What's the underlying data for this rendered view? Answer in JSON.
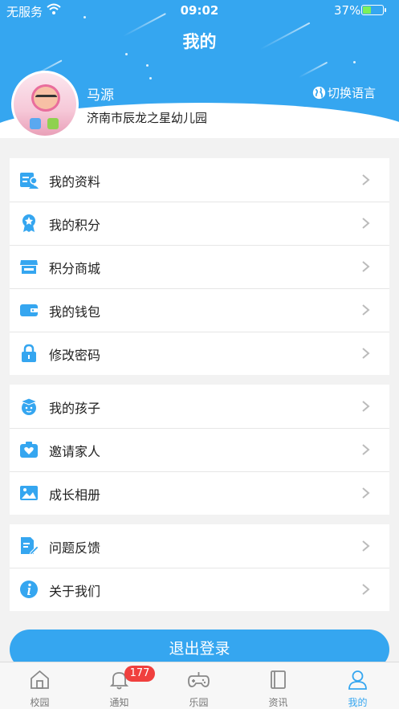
{
  "status_bar": {
    "carrier": "无服务",
    "time": "09:02",
    "battery_percent": "37%",
    "battery_level": 0.37
  },
  "header": {
    "title": "我的"
  },
  "profile": {
    "name": "马源",
    "school": "济南市辰龙之星幼儿园",
    "language_switch": "切换语言"
  },
  "menu_groups": [
    [
      {
        "label": "我的资料",
        "icon": "profile-card-icon"
      },
      {
        "label": "我的积分",
        "icon": "medal-icon"
      },
      {
        "label": "积分商城",
        "icon": "store-icon"
      },
      {
        "label": "我的钱包",
        "icon": "wallet-icon"
      },
      {
        "label": "修改密码",
        "icon": "lock-icon"
      }
    ],
    [
      {
        "label": "我的孩子",
        "icon": "graduate-icon"
      },
      {
        "label": "邀请家人",
        "icon": "heart-box-icon"
      },
      {
        "label": "成长相册",
        "icon": "photo-album-icon"
      }
    ],
    [
      {
        "label": "问题反馈",
        "icon": "feedback-edit-icon"
      },
      {
        "label": "关于我们",
        "icon": "info-icon"
      }
    ]
  ],
  "logout_label": "退出登录",
  "tabs": [
    {
      "label": "校园",
      "icon": "home-icon"
    },
    {
      "label": "通知",
      "icon": "bell-icon",
      "badge": "177"
    },
    {
      "label": "乐园",
      "icon": "gamepad-icon"
    },
    {
      "label": "资讯",
      "icon": "book-icon"
    },
    {
      "label": "我的",
      "icon": "person-icon",
      "active": true
    }
  ],
  "colors": {
    "primary": "#35a6f0",
    "badge": "#f0403e",
    "background": "#f2f2f2"
  }
}
